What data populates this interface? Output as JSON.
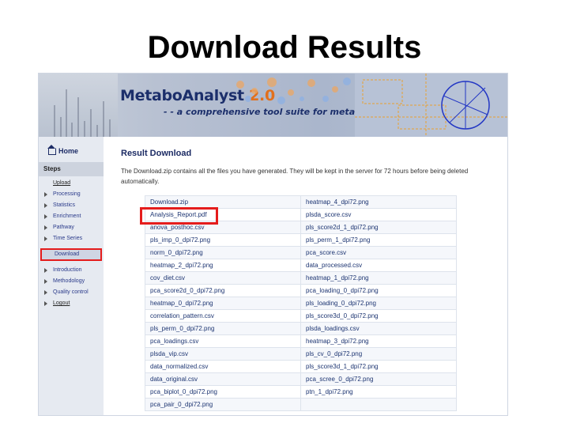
{
  "slide": {
    "title": "Download Results"
  },
  "banner": {
    "app_name": "MetaboAnalyst",
    "version": "2.0",
    "tagline": "- - a comprehensive tool suite for metabolomic data analysis"
  },
  "sidebar": {
    "home_label": "Home",
    "steps_heading": "Steps",
    "items": [
      {
        "label": "Upload"
      },
      {
        "label": "Processing"
      },
      {
        "label": "Statistics"
      },
      {
        "label": "Enrichment"
      },
      {
        "label": "Pathway"
      },
      {
        "label": "Time Series"
      },
      {
        "label": "Download"
      },
      {
        "label": "Introduction"
      },
      {
        "label": "Methodology"
      },
      {
        "label": "Quality control"
      },
      {
        "label": "Logout"
      }
    ]
  },
  "main": {
    "title": "Result Download",
    "description": "The Download.zip contains all the files you have generated. They will be kept in the server for 72 hours before being deleted automatically.",
    "files": [
      [
        "Download.zip",
        "heatmap_4_dpi72.png"
      ],
      [
        "Analysis_Report.pdf",
        "plsda_score.csv"
      ],
      [
        "anova_posthoc.csv",
        "pls_score2d_1_dpi72.png"
      ],
      [
        "pls_imp_0_dpi72.png",
        "pls_perm_1_dpi72.png"
      ],
      [
        "norm_0_dpi72.png",
        "pca_score.csv"
      ],
      [
        "heatmap_2_dpi72.png",
        "data_processed.csv"
      ],
      [
        "cov_diet.csv",
        "heatmap_1_dpi72.png"
      ],
      [
        "pca_score2d_0_dpi72.png",
        "pca_loading_0_dpi72.png"
      ],
      [
        "heatmap_0_dpi72.png",
        "pls_loading_0_dpi72.png"
      ],
      [
        "correlation_pattern.csv",
        "pls_score3d_0_dpi72.png"
      ],
      [
        "pls_perm_0_dpi72.png",
        "plsda_loadings.csv"
      ],
      [
        "pca_loadings.csv",
        "heatmap_3_dpi72.png"
      ],
      [
        "plsda_vip.csv",
        "pls_cv_0_dpi72.png"
      ],
      [
        "data_normalized.csv",
        "pls_score3d_1_dpi72.png"
      ],
      [
        "data_original.csv",
        "pca_scree_0_dpi72.png"
      ],
      [
        "pca_biplot_0_dpi72.png",
        "ptn_1_dpi72.png"
      ],
      [
        "pca_pair_0_dpi72.png",
        ""
      ]
    ]
  }
}
